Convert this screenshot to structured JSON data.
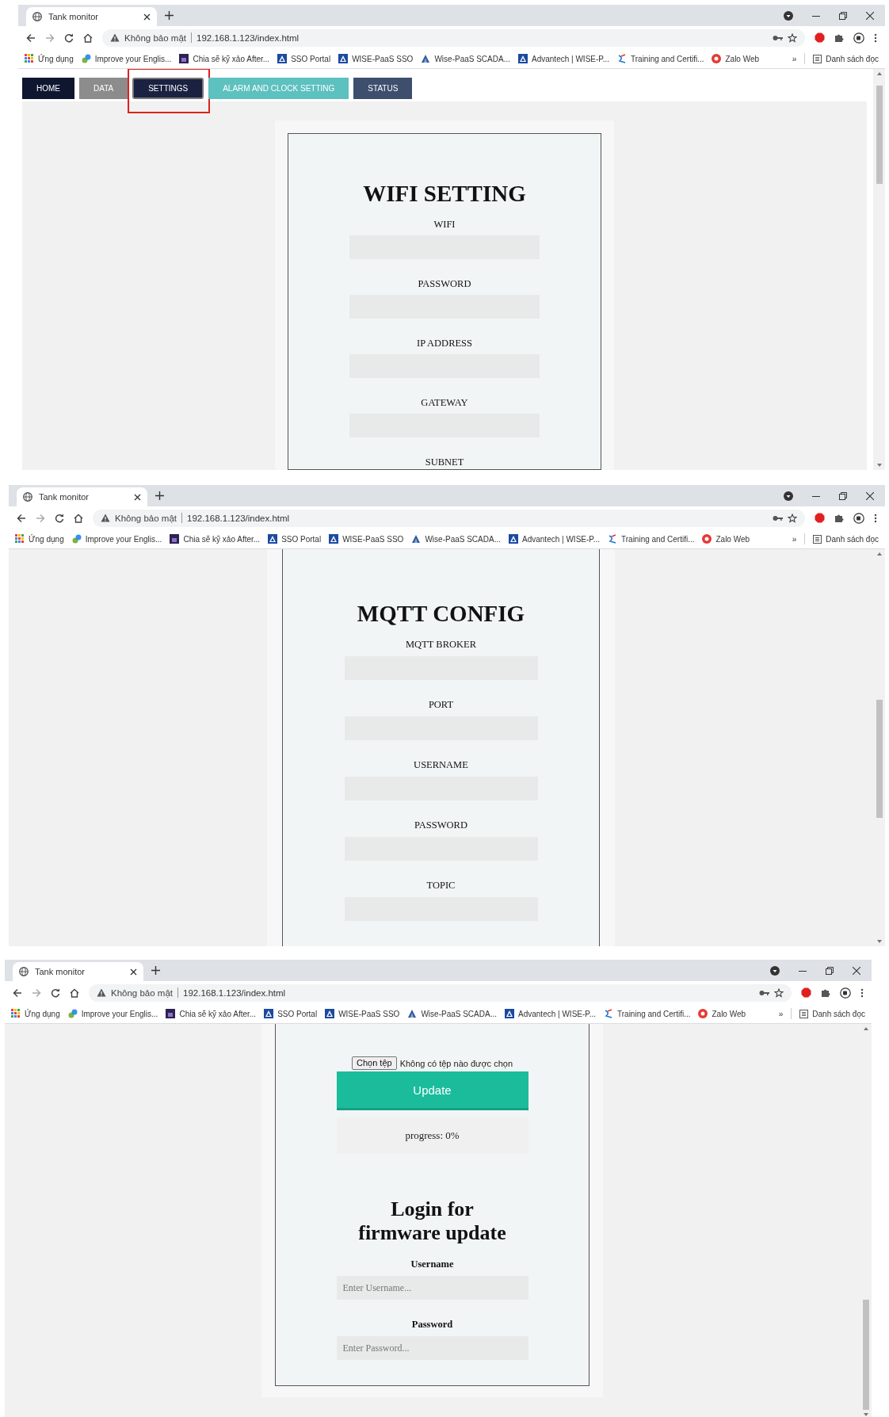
{
  "windows": [
    {
      "browser": {
        "tab_title": "Tank monitor",
        "security_label": "Không bảo mật",
        "url": "192.168.1.123/index.html",
        "bookmarks": [
          {
            "label": "Ứng dụng",
            "kind": "apps"
          },
          {
            "label": "Improve your Englis...",
            "kind": "leaf"
          },
          {
            "label": "Chia sẽ kỹ xảo After...",
            "kind": "film"
          },
          {
            "label": "SSO Portal",
            "kind": "square"
          },
          {
            "label": "WISE-PaaS SSO",
            "kind": "square"
          },
          {
            "label": "Wise-PaaS SCADA...",
            "kind": "triangle"
          },
          {
            "label": "Advantech | WISE-P...",
            "kind": "square"
          },
          {
            "label": "Training and Certifi...",
            "kind": "wave"
          },
          {
            "label": "Zalo Web",
            "kind": "circle"
          }
        ],
        "overflow": "»",
        "reading_list": "Danh sách đọc"
      },
      "page": {
        "nav": [
          {
            "label": "HOME",
            "selected": false,
            "highlighted": false,
            "color": "#0f1630"
          },
          {
            "label": "DATA",
            "selected": false,
            "highlighted": false,
            "color": "#8c8c8c"
          },
          {
            "label": "SETTINGS",
            "selected": true,
            "highlighted": true,
            "color": "#1b2140"
          },
          {
            "label": "ALARM AND CLOCK SETTING",
            "selected": false,
            "highlighted": false,
            "color": "#5dc1bf"
          },
          {
            "label": "STATUS",
            "selected": false,
            "highlighted": false,
            "color": "#3d4f6d"
          }
        ],
        "blocks": [
          {
            "kind": "title",
            "text": "WIFI SETTING"
          },
          {
            "kind": "field",
            "label": "WIFI"
          },
          {
            "kind": "field",
            "label": "PASSWORD"
          },
          {
            "kind": "field",
            "label": "IP ADDRESS"
          },
          {
            "kind": "field",
            "label": "GATEWAY"
          },
          {
            "kind": "label",
            "label": "SUBNET"
          }
        ]
      }
    },
    {
      "browser": {
        "tab_title": "Tank monitor",
        "security_label": "Không bảo mật",
        "url": "192.168.1.123/index.html",
        "bookmarks": [
          {
            "label": "Ứng dụng",
            "kind": "apps"
          },
          {
            "label": "Improve your Englis...",
            "kind": "leaf"
          },
          {
            "label": "Chia sẽ kỹ xảo After...",
            "kind": "film"
          },
          {
            "label": "SSO Portal",
            "kind": "square"
          },
          {
            "label": "WISE-PaaS SSO",
            "kind": "square"
          },
          {
            "label": "Wise-PaaS SCADA...",
            "kind": "triangle"
          },
          {
            "label": "Advantech | WISE-P...",
            "kind": "square"
          },
          {
            "label": "Training and Certifi...",
            "kind": "wave"
          },
          {
            "label": "Zalo Web",
            "kind": "circle"
          }
        ],
        "overflow": "»",
        "reading_list": "Danh sách đọc"
      },
      "page": {
        "blocks": [
          {
            "kind": "title",
            "text": "MQTT CONFIG"
          },
          {
            "kind": "field",
            "label": "MQTT BROKER"
          },
          {
            "kind": "field",
            "label": "PORT"
          },
          {
            "kind": "field",
            "label": "USERNAME"
          },
          {
            "kind": "field",
            "label": "PASSWORD"
          },
          {
            "kind": "field",
            "label": "TOPIC"
          }
        ]
      }
    },
    {
      "browser": {
        "tab_title": "Tank monitor",
        "security_label": "Không bảo mật",
        "url": "192.168.1.123/index.html",
        "bookmarks": [
          {
            "label": "Ứng dụng",
            "kind": "apps"
          },
          {
            "label": "Improve your Englis...",
            "kind": "leaf"
          },
          {
            "label": "Chia sẽ kỹ xảo After...",
            "kind": "film"
          },
          {
            "label": "SSO Portal",
            "kind": "square"
          },
          {
            "label": "WISE-PaaS SSO",
            "kind": "square"
          },
          {
            "label": "Wise-PaaS SCADA...",
            "kind": "triangle"
          },
          {
            "label": "Advantech | WISE-P...",
            "kind": "square"
          },
          {
            "label": "Training and Certifi...",
            "kind": "wave"
          },
          {
            "label": "Zalo Web",
            "kind": "circle"
          }
        ],
        "overflow": "»",
        "reading_list": "Danh sách đọc"
      },
      "page": {
        "blocks": [
          {
            "kind": "file-picker",
            "button": "Chọn tệp",
            "status": "Không có tệp nào được chọn"
          },
          {
            "kind": "button",
            "label": "Update"
          },
          {
            "kind": "progress",
            "text": "progress: 0%"
          },
          {
            "kind": "subtitle",
            "text": "Login for firmware update"
          },
          {
            "kind": "login-field",
            "label": "Username",
            "placeholder": "Enter Username..."
          },
          {
            "kind": "login-field",
            "label": "Password",
            "placeholder": "Enter Password..."
          }
        ]
      }
    }
  ]
}
